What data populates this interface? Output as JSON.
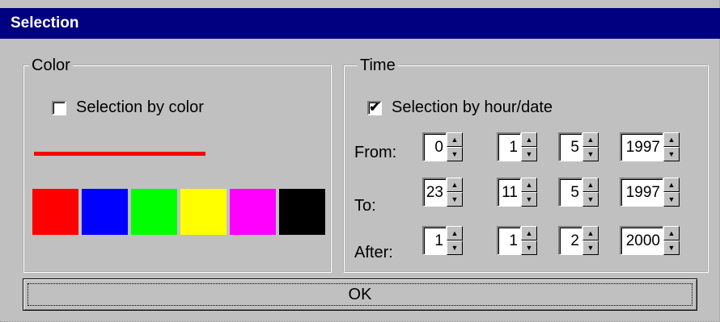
{
  "window": {
    "title": "Selection"
  },
  "color_group": {
    "legend": "Color",
    "checkbox_label": "Selection by color",
    "checked": false,
    "line_color": "#ff0000",
    "swatches": [
      "#ff0000",
      "#0000ff",
      "#00ff00",
      "#ffff00",
      "#ff00ff",
      "#000000"
    ]
  },
  "time_group": {
    "legend": "Time",
    "checkbox_label": "Selection by hour/date",
    "checked": true,
    "check_glyph": "✔",
    "rows": [
      {
        "label": "From:",
        "hour": "0",
        "day": "1",
        "month": "5",
        "year": "1997"
      },
      {
        "label": "To:",
        "hour": "23",
        "day": "11",
        "month": "5",
        "year": "1997"
      },
      {
        "label": "After:",
        "hour": "1",
        "day": "1",
        "month": "2",
        "year": "2000"
      }
    ]
  },
  "ok_button": {
    "label": "OK"
  },
  "icons": {
    "spin_up": "▲",
    "spin_down": "▼"
  }
}
